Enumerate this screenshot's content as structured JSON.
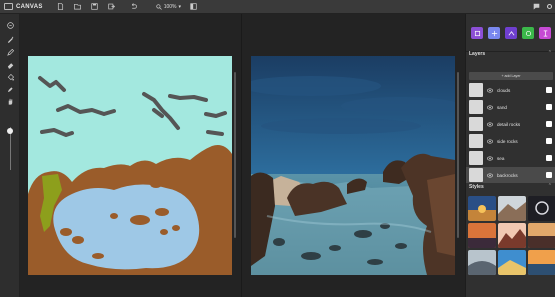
{
  "app": {
    "title": "CANVAS"
  },
  "toolbar": {
    "zoom_value": "100%",
    "icons": [
      "file-new-icon",
      "folder-open-icon",
      "save-icon",
      "export-icon",
      "undo-icon",
      "zoom-icon",
      "panel-toggle-icon"
    ]
  },
  "tools": [
    "pan-icon",
    "brush-icon",
    "pencil-icon",
    "eraser-icon",
    "fill-icon",
    "eyedropper-icon",
    "hand-icon"
  ],
  "brush_size_level": 0.1,
  "brushes": {
    "colors": [
      "#8c4fd6",
      "#7a88ef",
      "#6f3fd0",
      "#3bb84a",
      "#c64ad4"
    ]
  },
  "layers_panel": {
    "title": "Layers",
    "add_label": "+ add Layer",
    "layers": [
      {
        "name": "clouds",
        "selected": false
      },
      {
        "name": "sand",
        "selected": false
      },
      {
        "name": "detail rocks",
        "selected": false
      },
      {
        "name": "side rocks",
        "selected": false
      },
      {
        "name": "sea",
        "selected": false
      },
      {
        "name": "backrocks",
        "selected": true
      }
    ]
  },
  "styles_panel": {
    "title": "Styles"
  },
  "colors": {
    "sky": "#a3e8df",
    "water": "#9ec8e6",
    "rock": "#9a5c2a",
    "grass": "#8d9f1c",
    "cloud": "#555555"
  }
}
